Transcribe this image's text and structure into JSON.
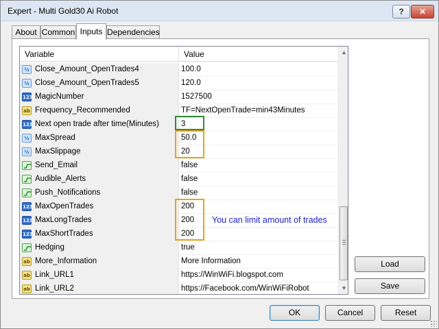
{
  "window": {
    "title": "Expert - Multi Gold30 Ai Robot",
    "help_glyph": "?",
    "close_glyph": "✕"
  },
  "tabs": [
    {
      "label": "About"
    },
    {
      "label": "Common"
    },
    {
      "label": "Inputs"
    },
    {
      "label": "Dependencies"
    }
  ],
  "active_tab": "Inputs",
  "grid": {
    "columns": {
      "variable": "Variable",
      "value": "Value"
    },
    "rows": [
      {
        "type": "double",
        "icon": "double-type-icon",
        "variable": "Close_Amount_OpenTrades4",
        "value": "100.0"
      },
      {
        "type": "double",
        "icon": "double-type-icon",
        "variable": "Close_Amount_OpenTrades5",
        "value": "120.0"
      },
      {
        "type": "int",
        "icon": "integer-type-icon",
        "variable": "MagicNumber",
        "value": "1527500"
      },
      {
        "type": "string",
        "icon": "string-type-icon",
        "variable": "Frequency_Recommended",
        "value": "TF=NextOpenTrade=min43Minutes"
      },
      {
        "type": "int",
        "icon": "integer-type-icon",
        "variable": "Next open trade after time(Minutes)",
        "value": "3"
      },
      {
        "type": "double",
        "icon": "double-type-icon",
        "variable": "MaxSpread",
        "value": "50.0"
      },
      {
        "type": "double",
        "icon": "double-type-icon",
        "variable": "MaxSlippage",
        "value": "20"
      },
      {
        "type": "bool",
        "icon": "boolean-type-icon",
        "variable": "Send_Email",
        "value": "false"
      },
      {
        "type": "bool",
        "icon": "boolean-type-icon",
        "variable": "Audible_Alerts",
        "value": "false"
      },
      {
        "type": "bool",
        "icon": "boolean-type-icon",
        "variable": "Push_Notifications",
        "value": "false"
      },
      {
        "type": "int",
        "icon": "integer-type-icon",
        "variable": "MaxOpenTrades",
        "value": "200"
      },
      {
        "type": "int",
        "icon": "integer-type-icon",
        "variable": "MaxLongTrades",
        "value": "200"
      },
      {
        "type": "int",
        "icon": "integer-type-icon",
        "variable": "MaxShortTrades",
        "value": "200"
      },
      {
        "type": "bool",
        "icon": "boolean-type-icon",
        "variable": "Hedging",
        "value": "true"
      },
      {
        "type": "string",
        "icon": "string-type-icon",
        "variable": "More_Information",
        "value": "More Information"
      },
      {
        "type": "string",
        "icon": "string-type-icon",
        "variable": "Link_URL1",
        "value": "https://WinWiFi.blogspot.com"
      },
      {
        "type": "string",
        "icon": "string-type-icon",
        "variable": "Link_URL2",
        "value": "https://Facebook.com/WinWiFiRobot"
      }
    ],
    "icon_glyphs": {
      "int": "123",
      "double": "½",
      "string": "ab"
    },
    "scroll_glyphs": {
      "up": "▲",
      "down": "▼"
    }
  },
  "annotation": "You can limit amount of trades",
  "colors": {
    "highlight_green": "#2e8b3a",
    "highlight_orange": "#e8a21c",
    "annotation": "#1c1cc8"
  },
  "buttons": {
    "load": "Load",
    "save": "Save",
    "ok": "OK",
    "cancel": "Cancel",
    "reset": "Reset"
  }
}
